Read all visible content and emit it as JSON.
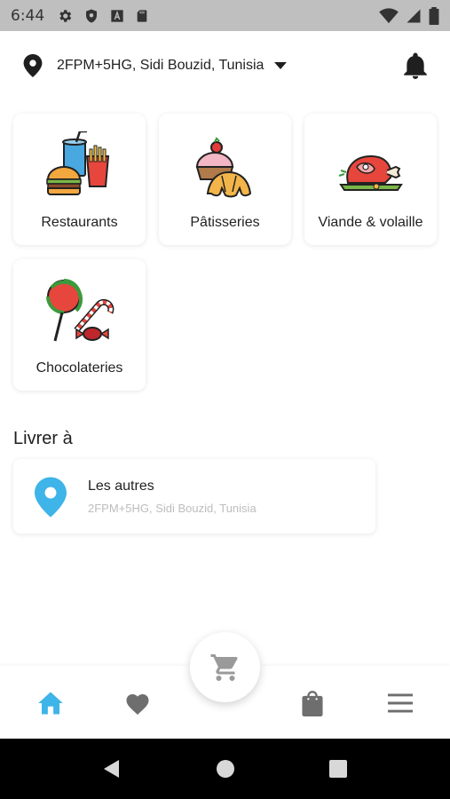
{
  "status_bar": {
    "time": "6:44",
    "icons": [
      "gear-icon",
      "shield-icon",
      "font-icon",
      "sd-card-icon",
      "wifi-icon",
      "cellular-icon",
      "battery-icon"
    ]
  },
  "header": {
    "location": "2FPM+5HG, Sidi Bouzid, Tunisia",
    "icons": [
      "location-pin-icon",
      "caret-down-icon",
      "bell-icon"
    ]
  },
  "categories": [
    {
      "label": "Restaurants",
      "icon": "fast-food-icon"
    },
    {
      "label": "Pâtisseries",
      "icon": "pastry-icon"
    },
    {
      "label": "Viande & volaille",
      "icon": "meat-icon"
    },
    {
      "label": "Chocolateries",
      "icon": "candy-icon"
    }
  ],
  "deliver": {
    "title": "Livrer à",
    "address_name": "Les autres",
    "address_detail": "2FPM+5HG, Sidi Bouzid, Tunisia"
  },
  "bottom_nav": {
    "items": [
      "home-icon",
      "heart-icon",
      "cart-icon",
      "shopping-bag-icon",
      "menu-icon"
    ],
    "active": "home-icon"
  },
  "colors": {
    "accent": "#3eb4e8",
    "inactive_icon": "#6e6e6e",
    "fab_icon": "#9a9a9a",
    "status_bar": "#bfbfbf"
  }
}
